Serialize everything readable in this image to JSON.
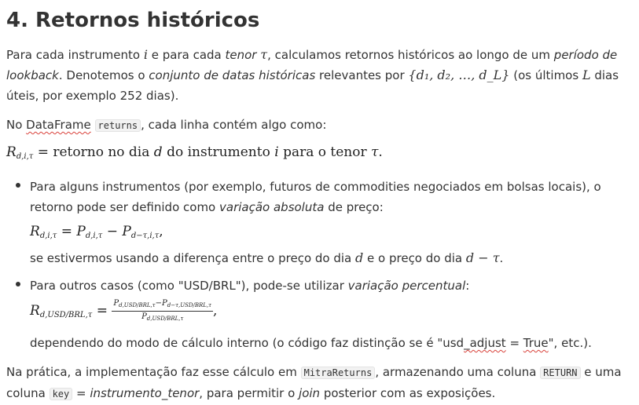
{
  "heading": "4. Retornos históricos",
  "p1": {
    "t1": "Para cada instrumento ",
    "m_i": "i",
    "t2": " e para cada ",
    "em_tenor": "tenor",
    "m_tau": "τ",
    "t3": ", calculamos retornos históricos ao longo de um ",
    "em_period": "período de lookback",
    "t4": ". Denotemos o ",
    "em_set": "conjunto de datas históricas",
    "t5": " relevantes por ",
    "m_set": "{d₁, d₂, …, d_L}",
    "t6": " (os últimos ",
    "m_L": "L",
    "t7": " dias úteis, por exemplo 252 dias)."
  },
  "p2": {
    "t1": "No ",
    "dataframe": "DataFrame",
    "code": "returns",
    "t2": ", cada linha contém algo como:"
  },
  "eq0": {
    "lhs": "R",
    "lhs_sub": "d,i,τ",
    "eq": " = ",
    "t1": "retorno no dia ",
    "d": "d",
    "t2": " do instrumento ",
    "i": "i",
    "t3": " para o tenor ",
    "tau": "τ",
    "end": "."
  },
  "li1": {
    "text_a": "Para alguns instrumentos (por exemplo, futuros de commodities negociados em bolsas locais), o retorno pode ser definido como ",
    "em": "variação absoluta",
    "text_b": " de preço:",
    "eq_R": "R",
    "eq_R_sub": "d,i,τ",
    "eq_mid": " = ",
    "eq_P1": "P",
    "eq_P1_sub": "d,i,τ",
    "eq_minus": " − ",
    "eq_P2": "P",
    "eq_P2_sub": "d−τ,i,τ",
    "eq_end": ",",
    "after_a": "se estivermos usando a diferença entre o preço do dia ",
    "after_d": "d",
    "after_b": " e o preço do dia ",
    "after_dt": "d − τ",
    "after_c": "."
  },
  "li2": {
    "text_a": "Para outros casos (como \"USD/BRL\"), pode-se utilizar ",
    "em": "variação percentual",
    "text_b": ":",
    "eq_R": "R",
    "eq_R_sub": "d,USD/BRL,τ",
    "eq_mid": " = ",
    "num_P1": "P",
    "num_P1_sub": "d,USD/BRL,τ",
    "num_minus": "−",
    "num_P2": "P",
    "num_P2_sub": "d−τ,USD/BRL,τ",
    "den_P": "P",
    "den_P_sub": "d,USD/BRL,τ",
    "eq_end": ",",
    "after_a": "dependendo do modo de cálculo interno (o código faz distinção se é \"usd",
    "after_adjust": "_adjust",
    "after_b": " = ",
    "after_true": "True",
    "after_c": "\", etc.)."
  },
  "p3": {
    "t1": "Na prática, a implementação faz esse cálculo em ",
    "code1": "MitraReturns",
    "t2": ", armazenando uma coluna ",
    "code2": "RETURN",
    "t3": " e uma coluna ",
    "code3": "key",
    "t4": " = ",
    "em1": "instrumento_tenor",
    "t5": ", para permitir o ",
    "em2": "join",
    "t6": " posterior com as exposições."
  }
}
